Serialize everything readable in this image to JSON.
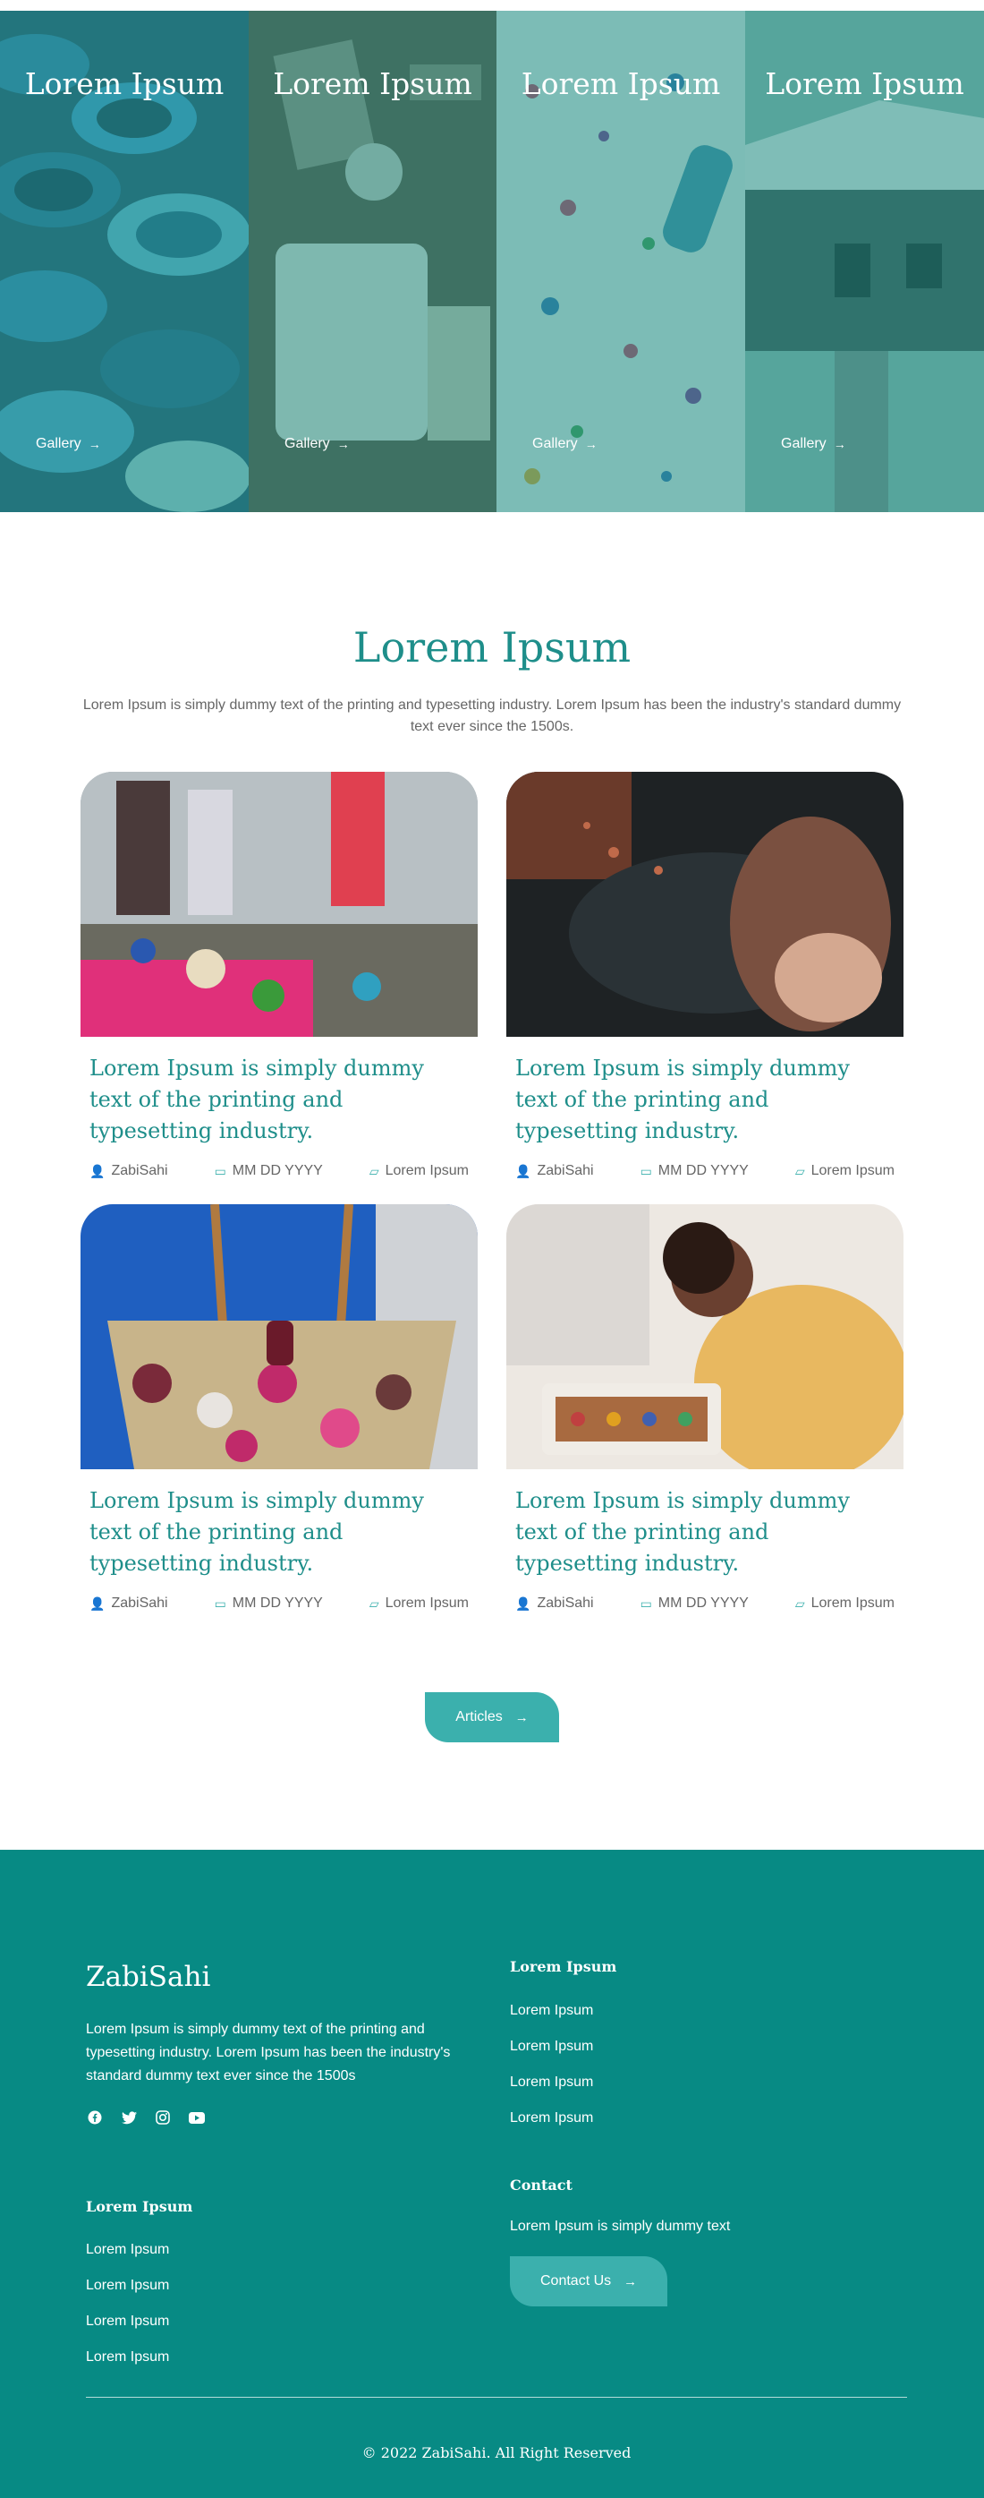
{
  "hero": {
    "panels": [
      {
        "title": "Lorem Ipsum",
        "link": "Gallery",
        "link_icon": "arrow-right-icon"
      },
      {
        "title": "Lorem Ipsum",
        "link": "Gallery",
        "link_icon": "arrow-right-icon"
      },
      {
        "title": "Lorem Ipsum",
        "link": "Gallery",
        "link_icon": "arrow-right-icon"
      },
      {
        "title": "Lorem Ipsum",
        "link": "Gallery",
        "link_icon": "arrow-right-icon"
      }
    ],
    "tint_color": "#2a968c"
  },
  "articles": {
    "title": "Lorem Ipsum",
    "description": "Lorem Ipsum is simply dummy text of the printing and typesetting industry. Lorem Ipsum has been the industry's standard dummy text ever since the 1500s.",
    "cards": [
      {
        "title": "Lorem Ipsum is simply dummy text of the printing and typesetting industry.",
        "author": "ZabiSahi",
        "date": "MM DD YYYY",
        "category": "Lorem Ipsum"
      },
      {
        "title": "Lorem Ipsum is simply dummy text of the printing and typesetting industry.",
        "author": "ZabiSahi",
        "date": "MM DD YYYY",
        "category": "Lorem Ipsum"
      },
      {
        "title": "Lorem Ipsum is simply dummy text of the printing and typesetting industry.",
        "author": "ZabiSahi",
        "date": "MM DD YYYY",
        "category": "Lorem Ipsum"
      },
      {
        "title": "Lorem Ipsum is simply dummy text of the printing and typesetting industry.",
        "author": "ZabiSahi",
        "date": "MM DD YYYY",
        "category": "Lorem Ipsum"
      }
    ],
    "button_label": "Articles",
    "accent_color": "#1e8e8a"
  },
  "footer": {
    "brand": "ZabiSahi",
    "description": "Lorem Ipsum is simply dummy text of the printing and typesetting industry. Lorem Ipsum has been the industry's standard dummy text ever since the 1500s",
    "socials": [
      "facebook-icon",
      "twitter-icon",
      "instagram-icon",
      "youtube-icon"
    ],
    "col1": {
      "heading": "Lorem Ipsum",
      "links": [
        "Lorem Ipsum",
        "Lorem Ipsum",
        "Lorem Ipsum",
        "Lorem Ipsum"
      ]
    },
    "col2": {
      "heading": "Lorem Ipsum",
      "links": [
        "Lorem Ipsum",
        "Lorem Ipsum",
        "Lorem Ipsum",
        "Lorem Ipsum"
      ]
    },
    "contact": {
      "heading": "Contact",
      "text": "Lorem Ipsum is simply dummy text",
      "button_label": "Contact Us"
    },
    "copyright": "© 2022 ZabiSahi. All Right Reserved",
    "background_color": "#078a84"
  }
}
